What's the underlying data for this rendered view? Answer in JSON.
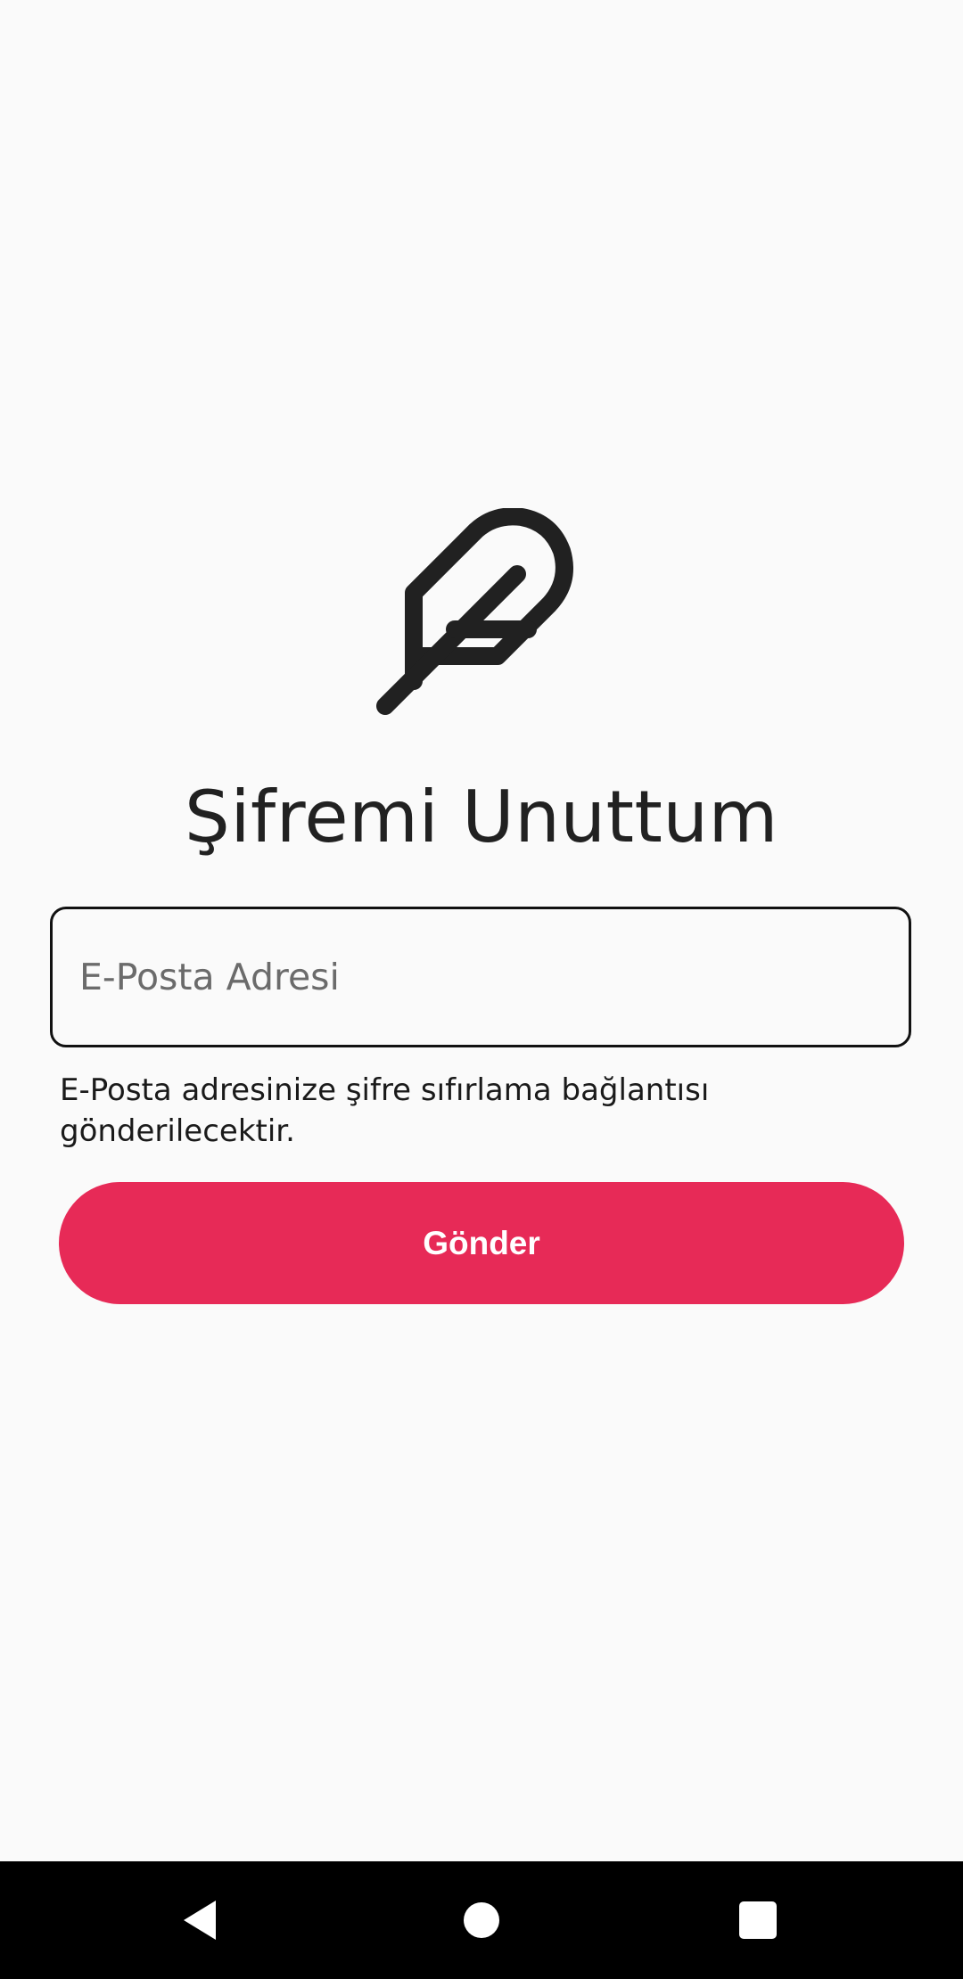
{
  "screen": {
    "title": "Şifremi Unuttum",
    "logo_icon": "feather-icon"
  },
  "form": {
    "email": {
      "value": "",
      "placeholder": "E-Posta Adresi"
    },
    "helper_text": "E-Posta adresinize şifre sıfırlama bağlantısı gönderilecektir.",
    "submit_label": "Gönder"
  },
  "system_nav": {
    "back_icon": "back-triangle-icon",
    "home_icon": "home-circle-icon",
    "recents_icon": "recents-square-icon"
  },
  "colors": {
    "background": "#fafafa",
    "accent": "#e72a57",
    "text": "#212121",
    "nav_bar": "#000000"
  }
}
